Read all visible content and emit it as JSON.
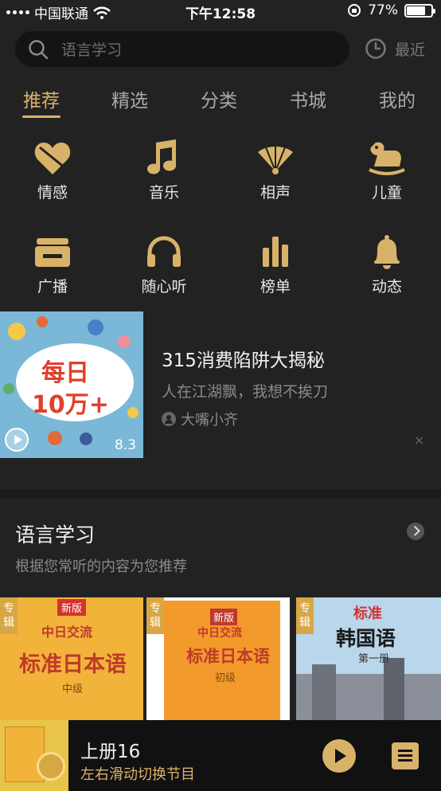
{
  "status_bar": {
    "carrier": "中国联通",
    "time": "下午12:58",
    "battery": "77%",
    "battery_level": 0.77
  },
  "search": {
    "placeholder": "语言学习"
  },
  "recent": {
    "label": "最近"
  },
  "tabs": [
    {
      "label": "推荐",
      "active": true
    },
    {
      "label": "精选"
    },
    {
      "label": "分类"
    },
    {
      "label": "书城"
    },
    {
      "label": "我的"
    }
  ],
  "categories": [
    {
      "label": "情感",
      "icon": "heart-icon"
    },
    {
      "label": "音乐",
      "icon": "music-note-icon"
    },
    {
      "label": "相声",
      "icon": "fan-icon"
    },
    {
      "label": "儿童",
      "icon": "rocking-horse-icon"
    },
    {
      "label": "广播",
      "icon": "radio-icon"
    },
    {
      "label": "随心听",
      "icon": "headphones-icon"
    },
    {
      "label": "榜单",
      "icon": "bar-chart-icon"
    },
    {
      "label": "动态",
      "icon": "bell-icon"
    }
  ],
  "feature": {
    "thumb_line1": "每日",
    "thumb_line2": "10万+",
    "score": "8.3",
    "title": "315消费陷阱大揭秘",
    "subtitle": "人在江湖飘，我想不挨刀",
    "author": "大嘴小齐",
    "close": "×"
  },
  "section": {
    "title": "语言学习",
    "subtitle": "根据您常听的内容为您推荐"
  },
  "albums": [
    {
      "tag": "专辑",
      "badge": "新版",
      "line1": "中日交流",
      "line2": "标准日本语",
      "line3": "中级"
    },
    {
      "tag": "专辑",
      "badge": "新版",
      "line1": "中日交流",
      "line2": "标准日本语",
      "line3": "初级"
    },
    {
      "tag": "专辑",
      "line1": "标准",
      "line2": "韩国语",
      "line3": "第一册"
    }
  ],
  "player": {
    "title": "上册16",
    "subtitle": "左右滑动切换节目"
  },
  "colors": {
    "accent": "#d9b26a",
    "background": "#222222"
  }
}
